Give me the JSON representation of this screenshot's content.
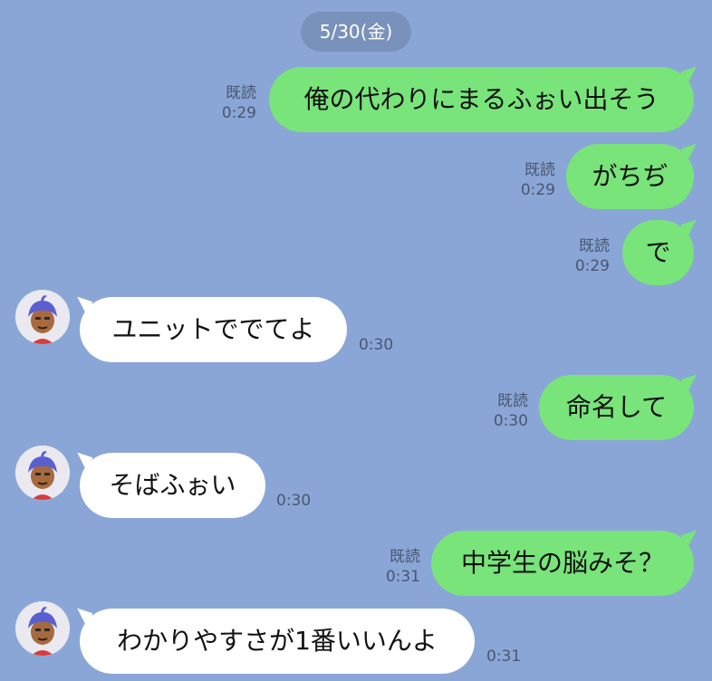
{
  "date_label": "5/30(金)",
  "read_label": "既読",
  "messages": [
    {
      "side": "out",
      "text": "俺の代わりにまるふぉい出そう",
      "time": "0:29"
    },
    {
      "side": "out",
      "text": "がちぢ",
      "time": "0:29"
    },
    {
      "side": "out",
      "text": "で",
      "time": "0:29"
    },
    {
      "side": "in",
      "text": "ユニットででてよ",
      "time": "0:30"
    },
    {
      "side": "out",
      "text": "命名して",
      "time": "0:30"
    },
    {
      "side": "in",
      "text": "そばふぉい",
      "time": "0:30"
    },
    {
      "side": "out",
      "text": "中学生の脳みそ？",
      "time": "0:31"
    },
    {
      "side": "in",
      "text": "わかりやすさが1番いいんよ",
      "time": "0:31"
    }
  ],
  "colors": {
    "background": "#8aa6d6",
    "sent_bubble": "#78e47a",
    "received_bubble": "#ffffff",
    "meta_text": "#4a5670"
  },
  "icons": {
    "avatar": "character-avatar-icon"
  }
}
